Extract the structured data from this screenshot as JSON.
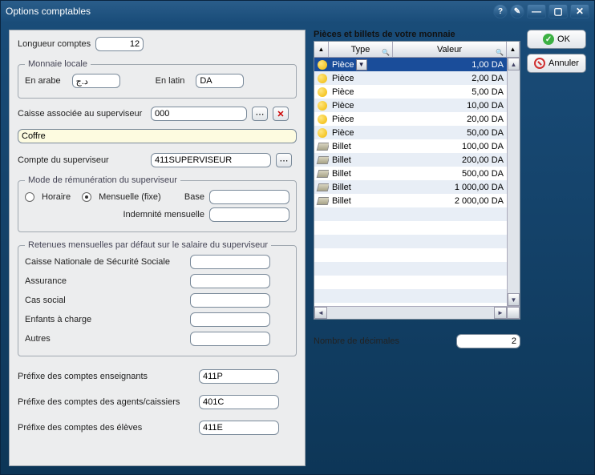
{
  "window": {
    "title": "Options comptables"
  },
  "left": {
    "longueur_label": "Longueur comptes",
    "longueur_value": "12",
    "monnaie_legend": "Monnaie locale",
    "arabe_label": "En arabe",
    "arabe_value": "د.ج",
    "latin_label": "En latin",
    "latin_value": "DA",
    "caisse_label": "Caisse associée au superviseur",
    "caisse_value": "000",
    "coffre_value": "Coffre",
    "compte_sup_label": "Compte du superviseur",
    "compte_sup_value": "411SUPERVISEUR",
    "mode_legend": "Mode de rémunération du superviseur",
    "horaire_label": "Horaire",
    "mensuelle_label": "Mensuelle (fixe)",
    "base_label": "Base",
    "base_value": "",
    "indemnite_label": "Indemnité mensuelle",
    "indemnite_value": "",
    "retenues_legend": "Retenues mensuelles par défaut sur le salaire du superviseur",
    "cnss_label": "Caisse Nationale de Sécurité Sociale",
    "cnss_value": "",
    "assurance_label": "Assurance",
    "assurance_value": "",
    "cas_label": "Cas social",
    "cas_value": "",
    "enfants_label": "Enfants à charge",
    "enfants_value": "",
    "autres_label": "Autres",
    "autres_value": "",
    "prefix_ens_label": "Préfixe des comptes enseignants",
    "prefix_ens_value": "411P",
    "prefix_agent_label": "Préfixe des comptes des agents/caissiers",
    "prefix_agent_value": "401C",
    "prefix_eleve_label": "Préfixe des comptes des élèves",
    "prefix_eleve_value": "411E"
  },
  "right": {
    "title": "Pièces et billets de votre monnaie",
    "col_type": "Type",
    "col_valeur": "Valeur",
    "rows": [
      {
        "icon": "coin",
        "type": "Pièce",
        "valeur": "1,00 DA",
        "selected": true
      },
      {
        "icon": "coin",
        "type": "Pièce",
        "valeur": "2,00 DA"
      },
      {
        "icon": "coin",
        "type": "Pièce",
        "valeur": "5,00 DA"
      },
      {
        "icon": "coin",
        "type": "Pièce",
        "valeur": "10,00 DA"
      },
      {
        "icon": "coin",
        "type": "Pièce",
        "valeur": "20,00 DA"
      },
      {
        "icon": "coin",
        "type": "Pièce",
        "valeur": "50,00 DA"
      },
      {
        "icon": "bill",
        "type": "Billet",
        "valeur": "100,00 DA"
      },
      {
        "icon": "bill",
        "type": "Billet",
        "valeur": "200,00 DA"
      },
      {
        "icon": "bill",
        "type": "Billet",
        "valeur": "500,00 DA"
      },
      {
        "icon": "bill",
        "type": "Billet",
        "valeur": "1 000,00 DA"
      },
      {
        "icon": "bill",
        "type": "Billet",
        "valeur": "2 000,00 DA"
      }
    ],
    "decimales_label": "Nombre de décimales",
    "decimales_value": "2"
  },
  "buttons": {
    "ok": "OK",
    "cancel": "Annuler"
  }
}
